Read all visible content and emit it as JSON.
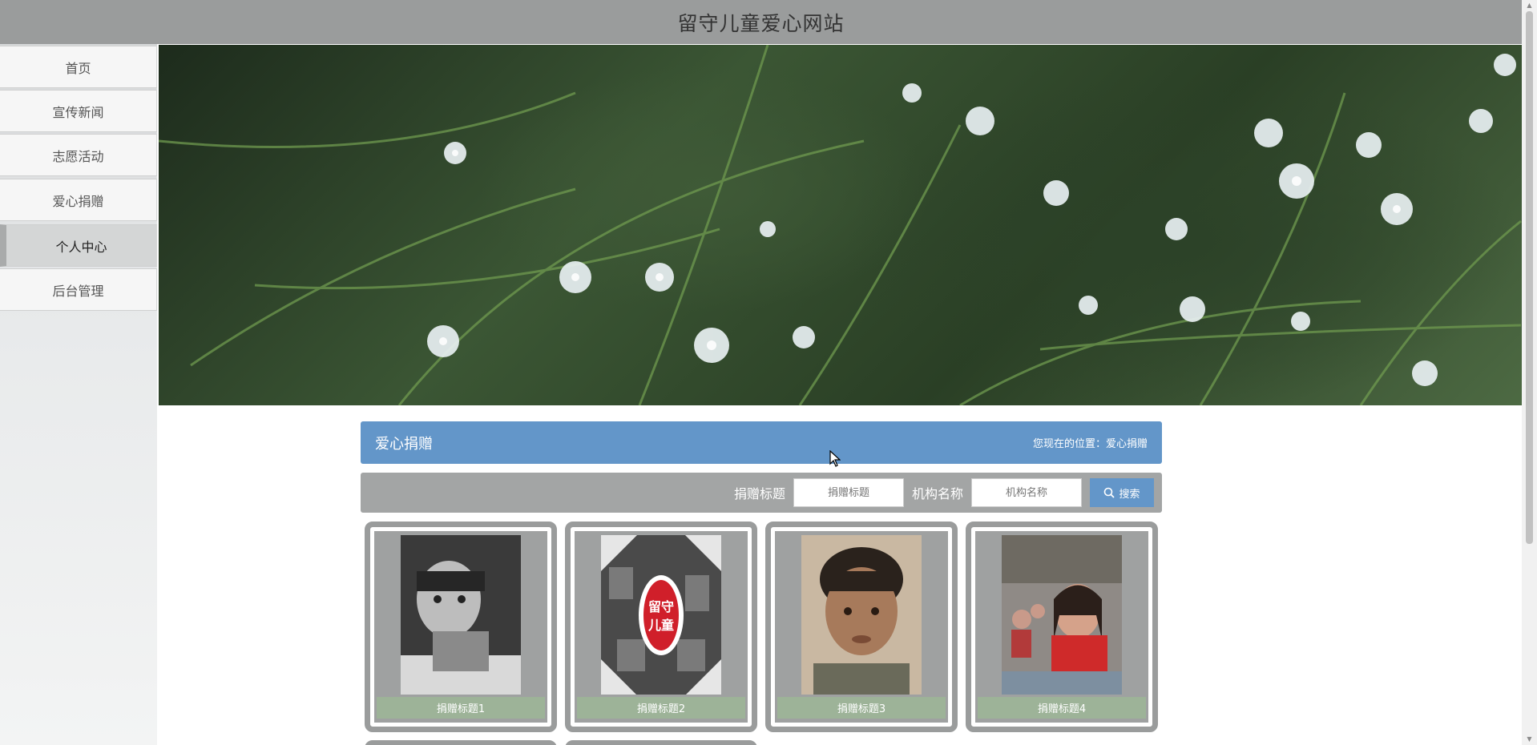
{
  "header": {
    "title": "留守儿童爱心网站"
  },
  "sidebar": {
    "items": [
      {
        "label": "首页"
      },
      {
        "label": "宣传新闻"
      },
      {
        "label": "志愿活动"
      },
      {
        "label": "爱心捐赠"
      },
      {
        "label": "个人中心",
        "active": true
      },
      {
        "label": "后台管理"
      }
    ]
  },
  "banner": {
    "slides": 3,
    "active_slide": 1
  },
  "section": {
    "title": "爱心捐赠",
    "breadcrumb": "您现在的位置：爱心捐赠"
  },
  "search": {
    "title_label": "捐赠标题",
    "title_placeholder": "捐赠标题",
    "org_label": "机构名称",
    "org_placeholder": "机构名称",
    "button_label": "搜索"
  },
  "cards": [
    {
      "title": "捐赠标题1"
    },
    {
      "title": "捐赠标题2"
    },
    {
      "title": "捐赠标题3"
    },
    {
      "title": "捐赠标题4"
    }
  ],
  "colors": {
    "accent": "#6396c9",
    "header": "#9a9c9c",
    "card_caption": "#9db398"
  }
}
